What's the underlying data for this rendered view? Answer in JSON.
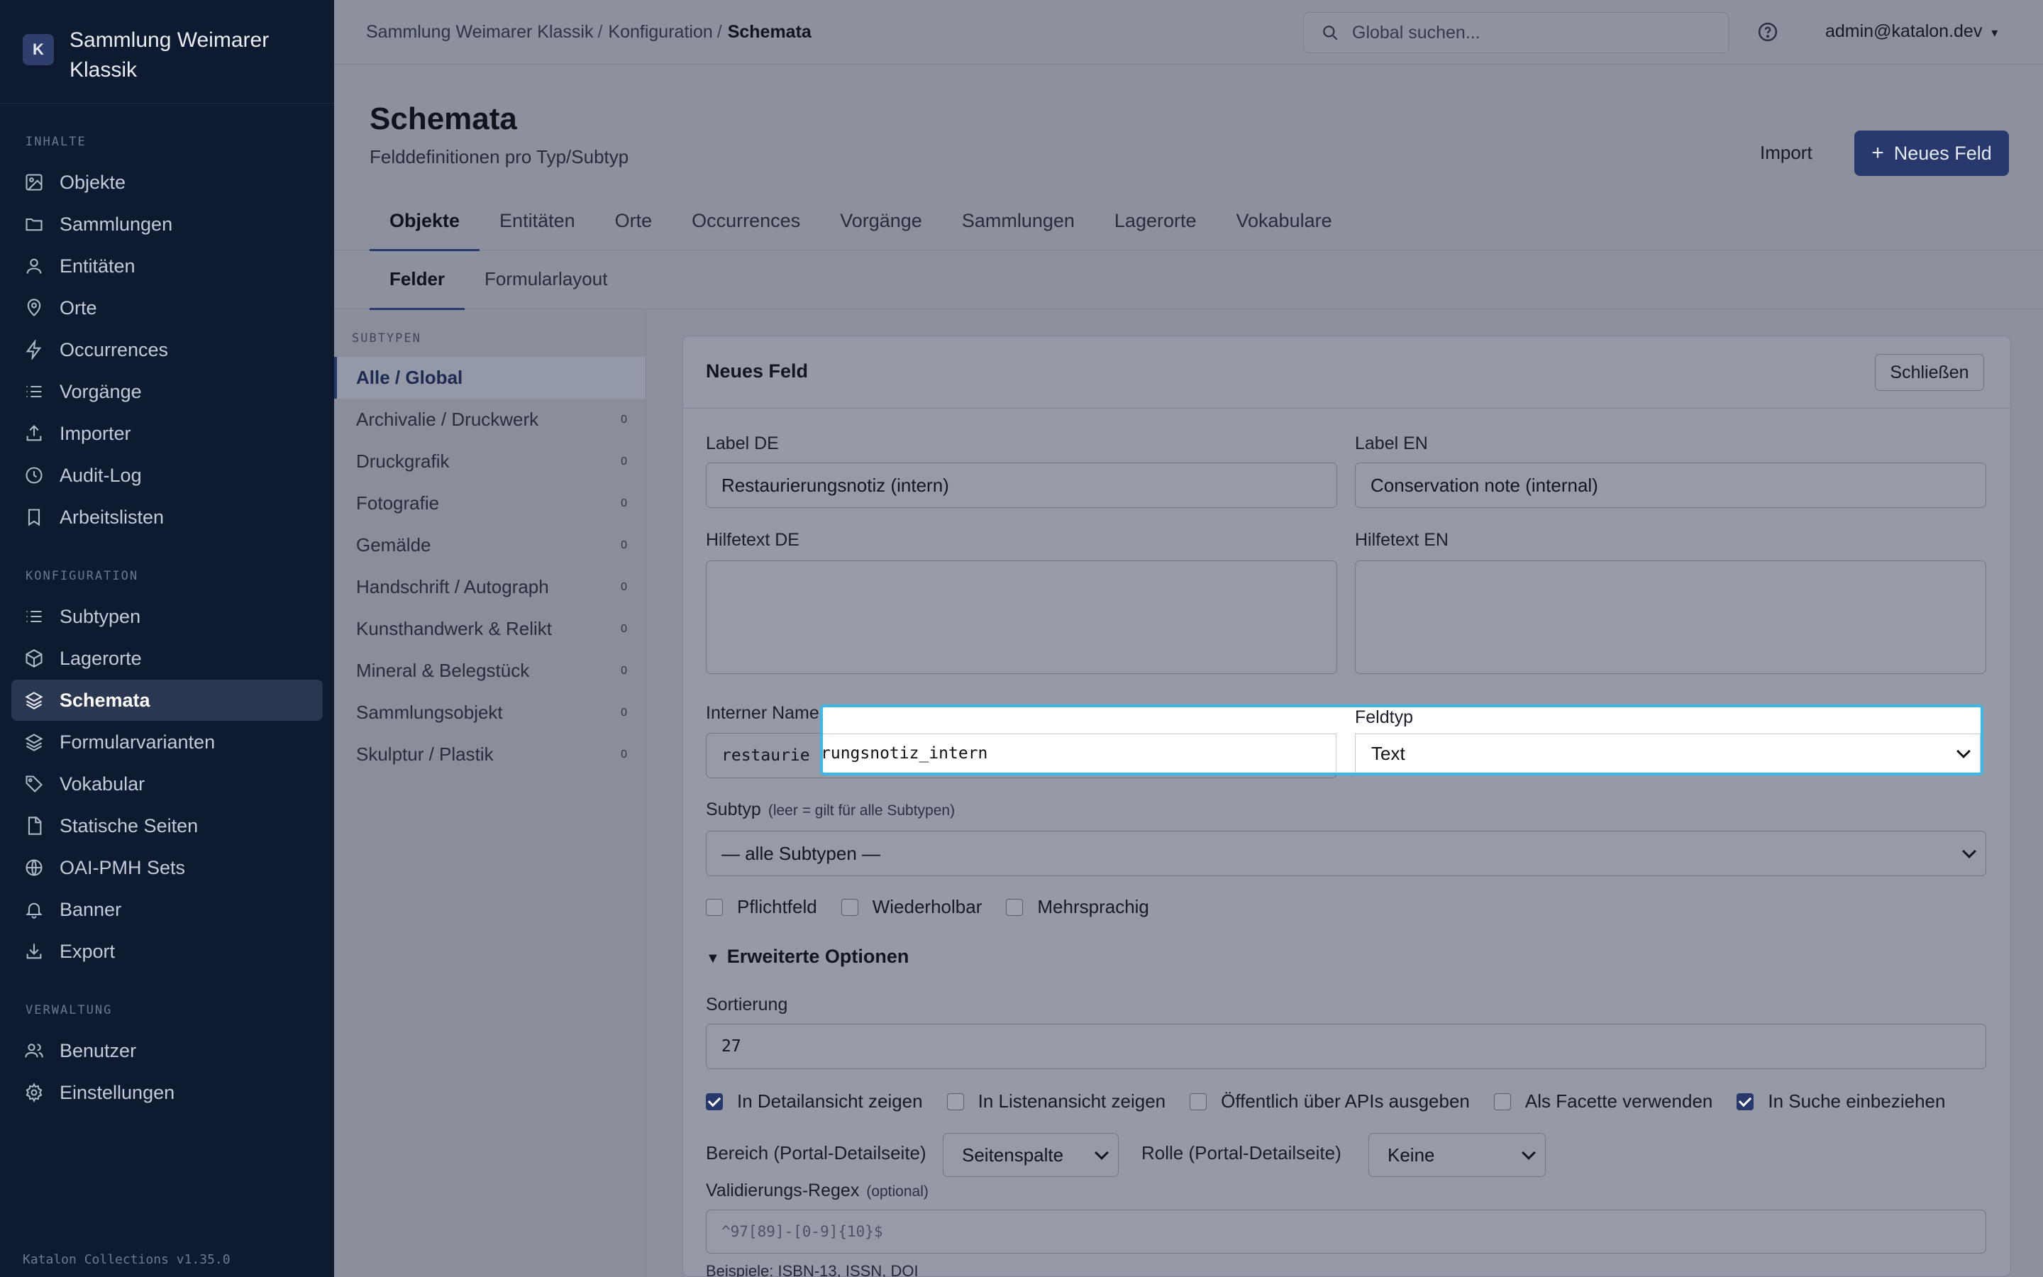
{
  "app": {
    "logo_letter": "K",
    "name": "Sammlung Weimarer Klassik",
    "version": "Katalon Collections v1.35.0"
  },
  "sidebar": {
    "sections": [
      {
        "title": "INHALTE",
        "items": [
          {
            "label": "Objekte",
            "icon": "image-icon"
          },
          {
            "label": "Sammlungen",
            "icon": "folder-icon"
          },
          {
            "label": "Entitäten",
            "icon": "user-icon"
          },
          {
            "label": "Orte",
            "icon": "map-pin-icon"
          },
          {
            "label": "Occurrences",
            "icon": "lightning-icon"
          },
          {
            "label": "Vorgänge",
            "icon": "list-icon"
          },
          {
            "label": "Importer",
            "icon": "upload-icon"
          },
          {
            "label": "Audit-Log",
            "icon": "clock-icon"
          },
          {
            "label": "Arbeitslisten",
            "icon": "bookmark-icon"
          }
        ]
      },
      {
        "title": "KONFIGURATION",
        "items": [
          {
            "label": "Subtypen",
            "icon": "list-icon"
          },
          {
            "label": "Lagerorte",
            "icon": "box-icon"
          },
          {
            "label": "Schemata",
            "icon": "layers-icon",
            "active": true
          },
          {
            "label": "Formularvarianten",
            "icon": "layers-icon"
          },
          {
            "label": "Vokabular",
            "icon": "tag-icon"
          },
          {
            "label": "Statische Seiten",
            "icon": "file-icon"
          },
          {
            "label": "OAI-PMH Sets",
            "icon": "globe-icon"
          },
          {
            "label": "Banner",
            "icon": "bell-icon"
          },
          {
            "label": "Export",
            "icon": "download-icon"
          }
        ]
      },
      {
        "title": "VERWALTUNG",
        "items": [
          {
            "label": "Benutzer",
            "icon": "users-icon"
          },
          {
            "label": "Einstellungen",
            "icon": "gear-icon"
          }
        ]
      }
    ]
  },
  "topbar": {
    "breadcrumb": [
      "Sammlung Weimarer Klassik",
      "Konfiguration",
      "Schemata"
    ],
    "breadcrumb_sep": "/",
    "search_placeholder": "Global suchen...",
    "user": "admin@katalon.dev",
    "user_caret": "▾"
  },
  "page": {
    "title": "Schemata",
    "subtitle": "Felddefinitionen pro Typ/Subtyp",
    "import_label": "Import",
    "new_field_label": "Neues Feld",
    "new_field_plus": "+"
  },
  "tabs": [
    "Objekte",
    "Entitäten",
    "Orte",
    "Occurrences",
    "Vorgänge",
    "Sammlungen",
    "Lagerorte",
    "Vokabulare"
  ],
  "subtabs": [
    "Felder",
    "Formularlayout"
  ],
  "subtypes": {
    "title": "SUBTYPEN",
    "items": [
      {
        "label": "Alle / Global",
        "count": "",
        "active": true
      },
      {
        "label": "Archivalie / Druckwerk",
        "count": "0"
      },
      {
        "label": "Druckgrafik",
        "count": "0"
      },
      {
        "label": "Fotografie",
        "count": "0"
      },
      {
        "label": "Gemälde",
        "count": "0"
      },
      {
        "label": "Handschrift / Autograph",
        "count": "0"
      },
      {
        "label": "Kunsthandwerk & Relikt",
        "count": "0"
      },
      {
        "label": "Mineral & Belegstück",
        "count": "0"
      },
      {
        "label": "Sammlungsobjekt",
        "count": "0"
      },
      {
        "label": "Skulptur / Plastik",
        "count": "0"
      }
    ]
  },
  "form": {
    "title": "Neues Feld",
    "close_label": "Schließen",
    "label_de": {
      "label": "Label DE",
      "value": "Restaurierungsnotiz (intern)"
    },
    "label_en": {
      "label": "Label EN",
      "value": "Conservation note (internal)"
    },
    "help_de": {
      "label": "Hilfetext DE",
      "value": ""
    },
    "help_en": {
      "label": "Hilfetext EN",
      "value": ""
    },
    "internal_name": {
      "label": "Interner Name",
      "value_head": "restaurie",
      "value_tail": "rungsnotiz_intern"
    },
    "field_type": {
      "label": "Feldtyp",
      "value": "Text"
    },
    "subtype": {
      "label": "Subtyp",
      "hint": "(leer = gilt für alle Subtypen)",
      "value": "— alle Subtypen —"
    },
    "flags": [
      {
        "label": "Pflichtfeld",
        "checked": false
      },
      {
        "label": "Wiederholbar",
        "checked": false
      },
      {
        "label": "Mehrsprachig",
        "checked": false
      }
    ],
    "advanced_label": "Erweiterte Optionen",
    "advanced_triangle": "▼",
    "sort": {
      "label": "Sortierung",
      "value": "27"
    },
    "visibility": [
      {
        "label": "In Detailansicht zeigen",
        "checked": true
      },
      {
        "label": "In Listenansicht zeigen",
        "checked": false
      },
      {
        "label": "Öffentlich über APIs ausgeben",
        "checked": false
      },
      {
        "label": "Als Facette verwenden",
        "checked": false
      },
      {
        "label": "In Suche einbeziehen",
        "checked": true
      }
    ],
    "area": {
      "label": "Bereich (Portal-Detailseite)",
      "value": "Seitenspalte"
    },
    "role": {
      "label": "Rolle (Portal-Detailseite)",
      "value": "Keine"
    },
    "regex": {
      "label": "Validierungs-Regex",
      "hint": "(optional)",
      "placeholder": "^97[89]-[0-9]{10}$",
      "examples": "Beispiele: ISBN-13, ISSN, DOI"
    }
  },
  "colors": {
    "sidebar_bg": "#0e1a30",
    "accent": "#27386c",
    "focus_ring": "#3bb8e8"
  }
}
